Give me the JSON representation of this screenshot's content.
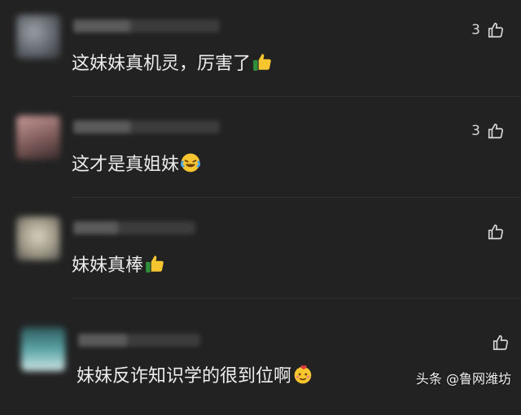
{
  "comments": [
    {
      "like_count": "3",
      "text": "这妹妹真机灵，厉害了",
      "emoji": "thumbs-up-icon"
    },
    {
      "like_count": "3",
      "text": "这才是真姐妹",
      "emoji": "laughing-tears-icon"
    },
    {
      "like_count": "",
      "text": "妹妹真棒",
      "emoji": "thumbs-up-icon"
    },
    {
      "like_count": "",
      "text": "妹妹反诈知识学的很到位啊",
      "emoji": "admiring-face-icon"
    }
  ],
  "watermark": "头条 @鲁网潍坊",
  "colors": {
    "background": "#222222",
    "text": "#ededed",
    "like_icon": "#d8d8d8"
  }
}
